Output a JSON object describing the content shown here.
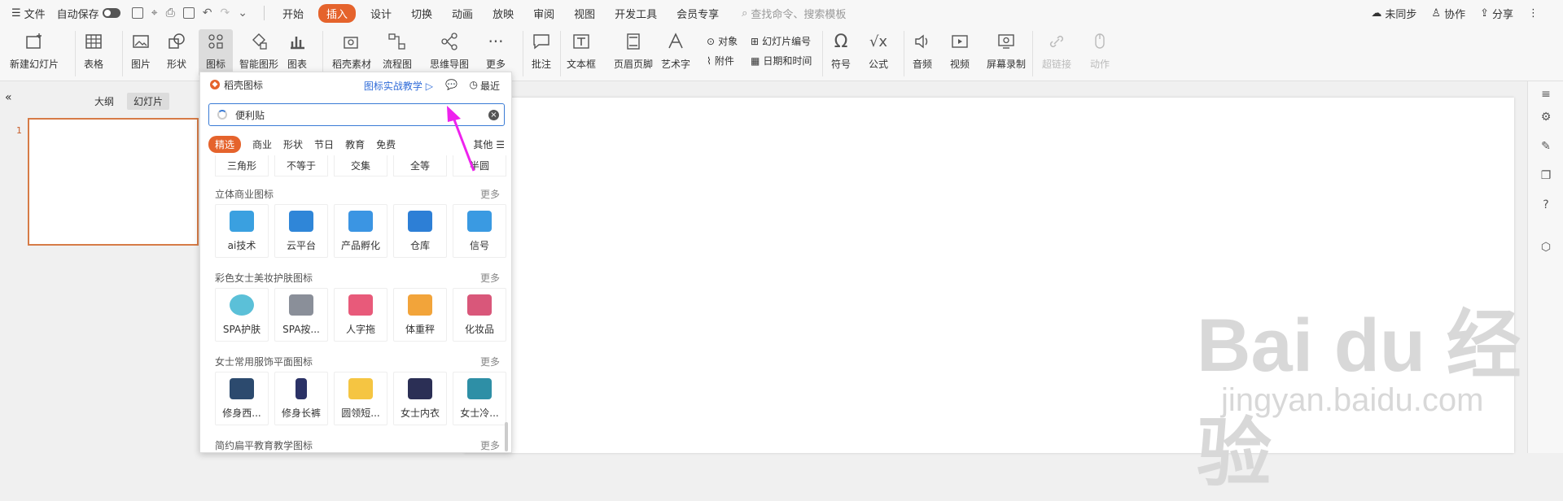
{
  "menubar": {
    "file": "文件",
    "autosave": "自动保存",
    "tabs": [
      "开始",
      "插入",
      "设计",
      "切换",
      "动画",
      "放映",
      "审阅",
      "视图",
      "开发工具",
      "会员专享"
    ],
    "active_tab": 1,
    "search_placeholder": "查找命令、搜索模板",
    "right": [
      "未同步",
      "协作",
      "分享"
    ]
  },
  "ribbon": {
    "new_slide": "新建幻灯片",
    "table": "表格",
    "picture": "图片",
    "shape": "形状",
    "icon": "图标",
    "smart": "智能图形",
    "chart": "图表",
    "material": "稻壳素材",
    "flow": "流程图",
    "mindmap": "思维导图",
    "more": "更多",
    "comment": "批注",
    "textbox": "文本框",
    "header_footer": "页眉页脚",
    "art_text": "艺术字",
    "object": "对象",
    "attach": "附件",
    "slide_num": "幻灯片编号",
    "datetime": "日期和时间",
    "symbol": "符号",
    "formula": "公式",
    "audio": "音频",
    "video": "视频",
    "screen_rec": "屏幕录制",
    "hyperlink": "超链接",
    "action": "动作"
  },
  "leftpanel": {
    "outline": "大纲",
    "slides": "幻灯片",
    "slide_num": "1"
  },
  "dropdown": {
    "title": "稻壳图标",
    "tutorial": "图标实战教学",
    "recent": "最近",
    "search_value": "便利贴",
    "categories": [
      "精选",
      "商业",
      "形状",
      "节日",
      "教育",
      "免费"
    ],
    "cat_more": "其他",
    "top_row": [
      "三角形",
      "不等于",
      "交集",
      "全等",
      "半圆"
    ],
    "sections": [
      {
        "title": "立体商业图标",
        "more": "更多",
        "items": [
          "ai技术",
          "云平台",
          "产品孵化",
          "仓库",
          "信号"
        ]
      },
      {
        "title": "彩色女士美妆护肤图标",
        "more": "更多",
        "items": [
          "SPA护肤",
          "SPA按...",
          "人字拖",
          "体重秤",
          "化妆品"
        ]
      },
      {
        "title": "女士常用服饰平面图标",
        "more": "更多",
        "items": [
          "修身西...",
          "修身长裤",
          "圆领短...",
          "女士内衣",
          "女士冷..."
        ]
      },
      {
        "title": "简约扁平教育教学图标",
        "more": "更多"
      }
    ]
  },
  "watermark": {
    "main": "Bai du 经验",
    "sub": "jingyan.baidu.com"
  },
  "colors": {
    "accent": "#e5632c",
    "link": "#2f6bd8",
    "arrow": "#ee22ee"
  }
}
